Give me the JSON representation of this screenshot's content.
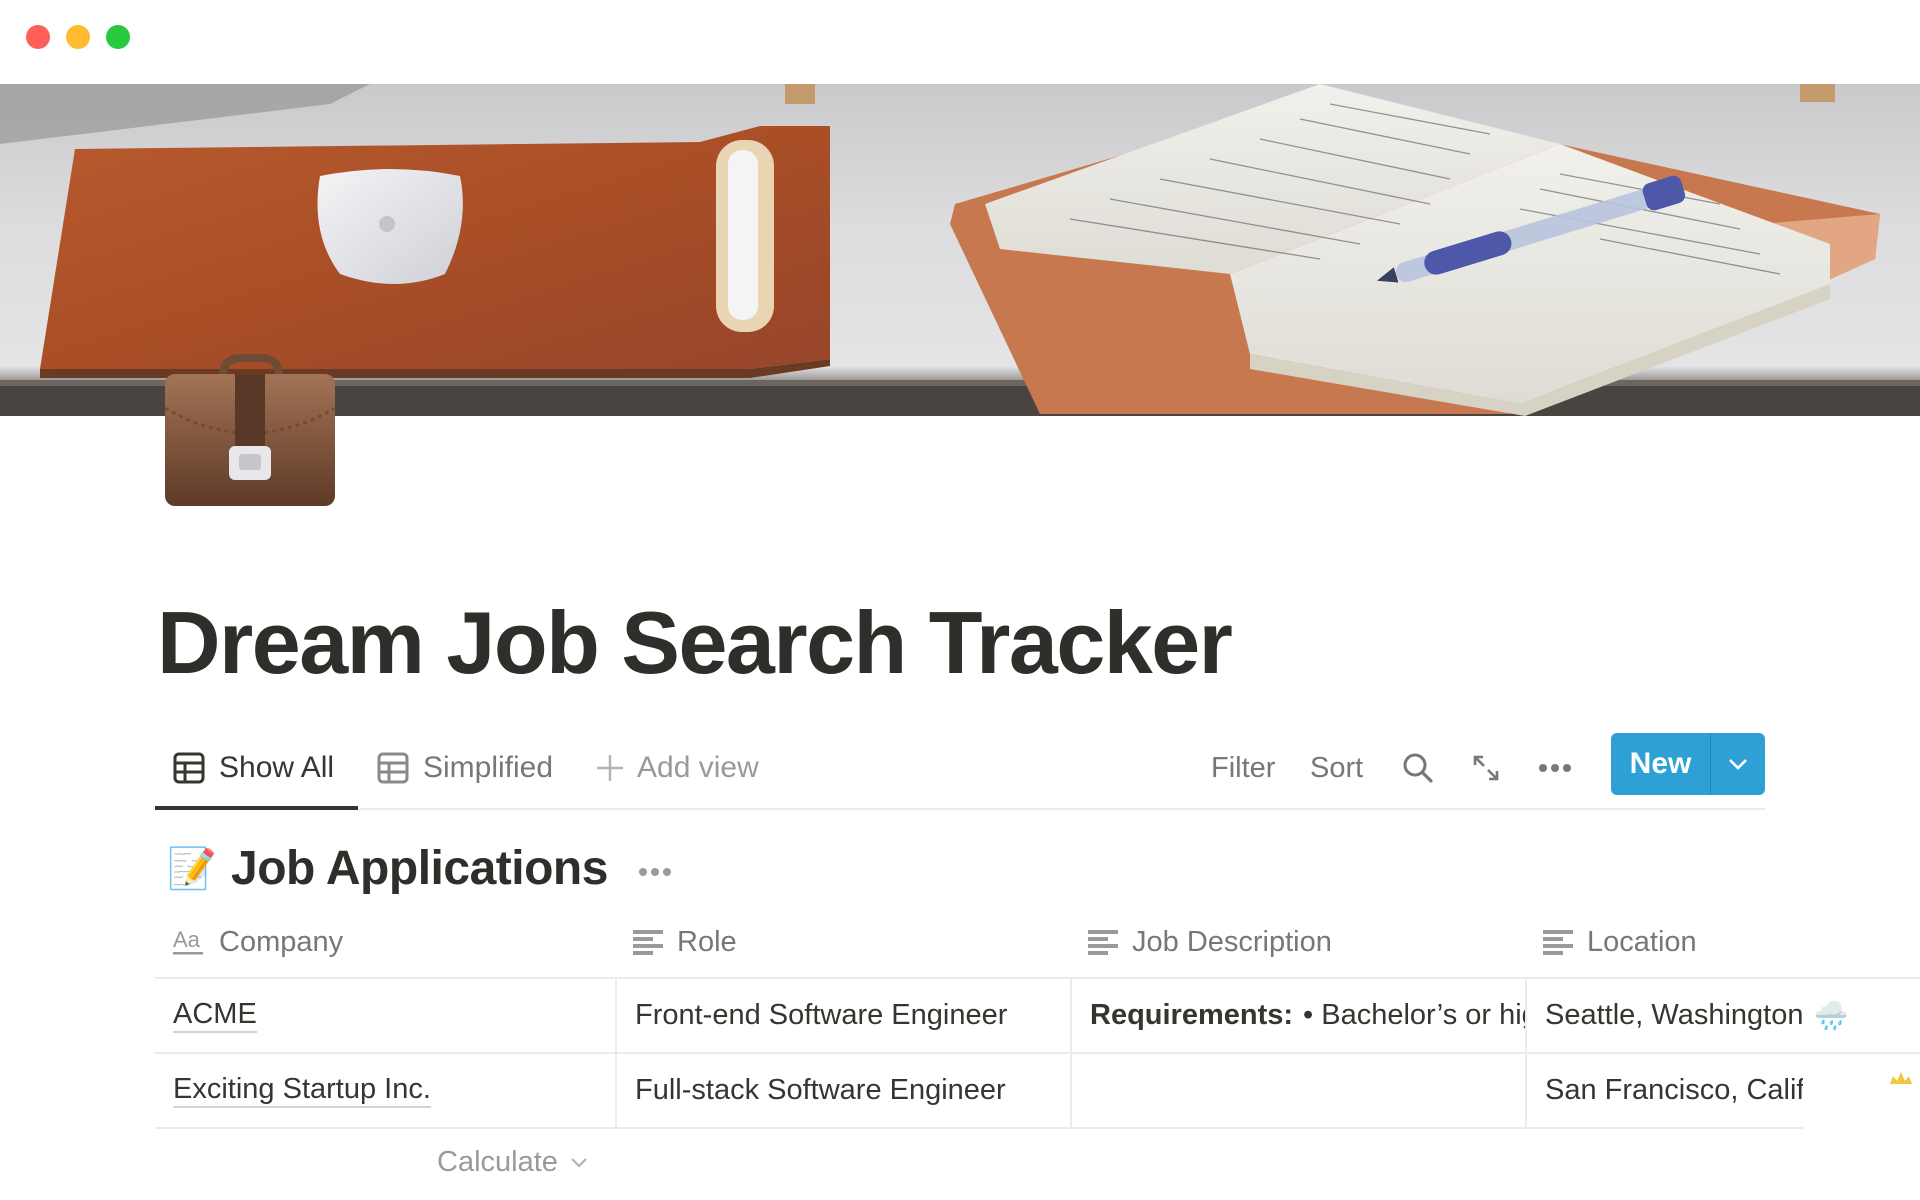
{
  "window": {
    "controls": [
      "close",
      "minimize",
      "maximize"
    ]
  },
  "cover": {
    "description": "Leather desk pad with white mouse and pen, open notebook with blue pen"
  },
  "page": {
    "icon": "briefcase-icon",
    "title": "Dream Job Search Tracker"
  },
  "views": {
    "tabs": [
      {
        "label": "Show All",
        "icon": "table-icon",
        "active": true
      },
      {
        "label": "Simplified",
        "icon": "table-icon",
        "active": false
      }
    ],
    "add_view_label": "Add view"
  },
  "toolbar": {
    "filter_label": "Filter",
    "sort_label": "Sort",
    "search_icon": "search-icon",
    "expand_icon": "expand-icon",
    "more_icon": "more-icon",
    "new_label": "New",
    "accent": "#2ea0d6"
  },
  "database": {
    "emoji": "📝",
    "title": "Job Applications",
    "columns": [
      {
        "label": "Company",
        "icon": "title-property-icon"
      },
      {
        "label": "Role",
        "icon": "text-property-icon"
      },
      {
        "label": "Job Description",
        "icon": "text-property-icon"
      },
      {
        "label": "Location",
        "icon": "text-property-icon"
      }
    ],
    "rows": [
      {
        "company": "ACME",
        "role": "Front-end Software Engineer",
        "job_description_bold": "Requirements:",
        "job_description": "• Bachelor’s or higher",
        "location": "Seattle, Washington",
        "location_emoji": "🌧️"
      },
      {
        "company": "Exciting Startup Inc.",
        "role": "Full-stack Software Engineer",
        "job_description_bold": "",
        "job_description": "",
        "location": "San Francisco, California",
        "location_emoji": "☀️"
      }
    ],
    "calculate_label": "Calculate"
  }
}
